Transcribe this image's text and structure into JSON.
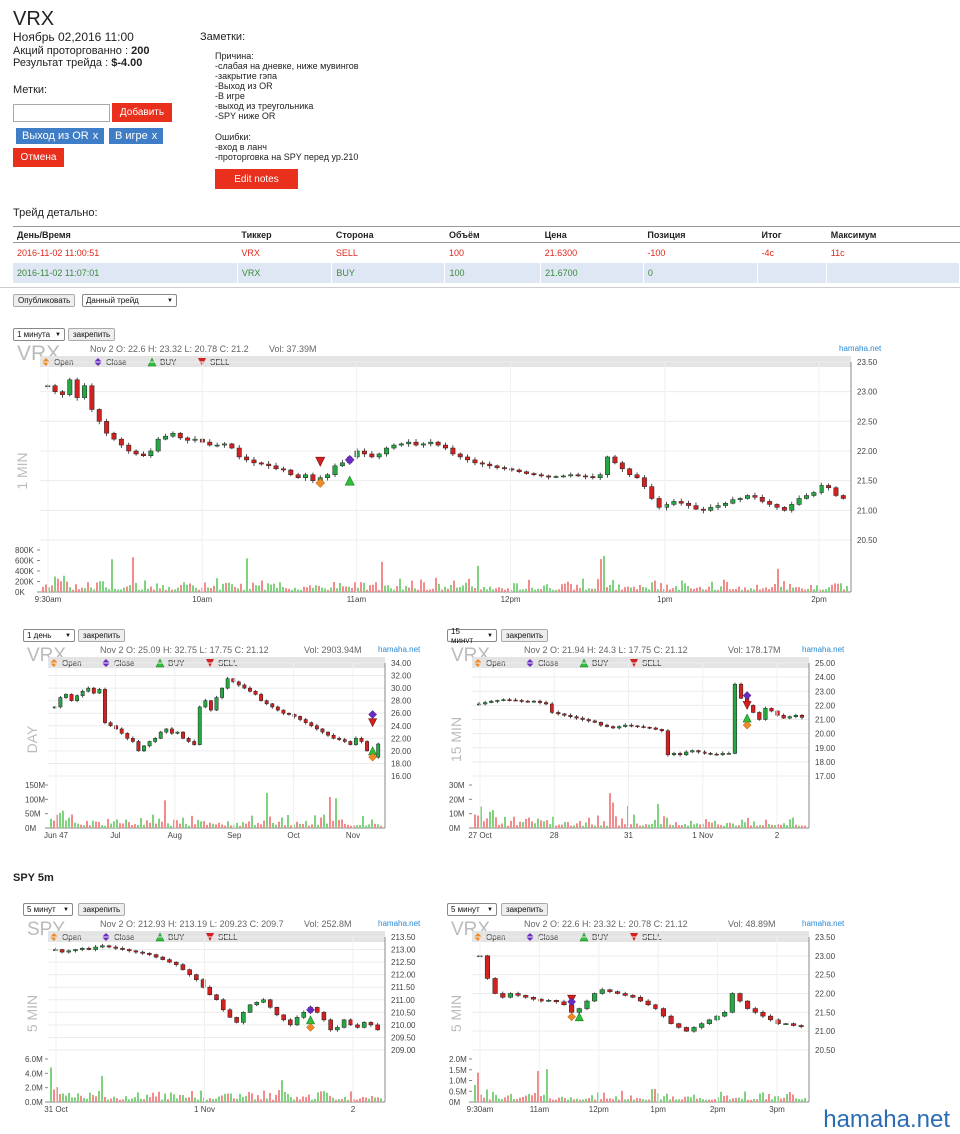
{
  "header": {
    "ticker": "VRX",
    "date": "Ноябрь 02,2016 11:00",
    "shares_label": "Акций проторгованно :",
    "shares_value": "200",
    "result_label": "Результат трейда :",
    "result_value": "$-4.00"
  },
  "tags": {
    "label": "Метки:",
    "input_value": "",
    "add_button": "Добавить",
    "chips": [
      "Выход из OR",
      "В игре"
    ],
    "chip_remove": "x",
    "cancel_button": "Отмена"
  },
  "notes": {
    "label": "Заметки:",
    "reasons_title": "Причина:",
    "reasons": [
      "-слабая на дневке, ниже мувингов",
      "-закрытие гэпа",
      "-Выход из OR",
      "-В игре",
      "-выход из треугольника",
      "-SPY ниже OR"
    ],
    "errors_title": "Ошибки:",
    "errors": [
      "-вход в ланч",
      "-проторговка на SPY перед ур.210"
    ],
    "edit_button": "Edit notes"
  },
  "trade_detail": {
    "label": "Трейд детально:",
    "columns": [
      "День/Время",
      "Тиккер",
      "Сторона",
      "Объём",
      "Цена",
      "Позиция",
      "Итог",
      "Максимум"
    ],
    "rows": [
      [
        "2016-11-02 11:00:51",
        "VRX",
        "SELL",
        "100",
        "21.6300",
        "-100",
        "-4c",
        "11c"
      ],
      [
        "2016-11-02 11:07:01",
        "VRX",
        "BUY",
        "100",
        "21.6700",
        "0",
        "",
        ""
      ]
    ]
  },
  "actions": {
    "publish_button": "Опубликовать",
    "scope_select": "Данный трейд"
  },
  "spy_label": "SPY 5m",
  "watermark": "hamaha.net",
  "colors": {
    "up": "#27a744",
    "down": "#d32020",
    "vol_up": "#7fd37f",
    "vol_down": "#f28b8b",
    "accent_red": "#e8301d",
    "chip_blue": "#3f7ec6",
    "link_blue": "#2a8ad4"
  },
  "charts": [
    {
      "id": "c1",
      "interval_select": "1 минута",
      "pin_button": "закрепить",
      "symbol": "VRX",
      "tf_label": "1 MIN",
      "info": "Nov 2 O: 22.6 H: 23.32 L: 20.78 C: 21.2",
      "vol": "Vol: 37.39M",
      "brand": "hamaha.net",
      "legend": [
        "Open",
        "Close",
        "BUY",
        "SELL"
      ],
      "y_ticks": [
        "23.50",
        "23.00",
        "22.50",
        "22.00",
        "21.50",
        "21.00",
        "20.50"
      ],
      "vol_ticks": [
        "800K",
        "600K",
        "400K",
        "200K",
        "0K"
      ],
      "x_ticks": [
        "9:30am",
        "10am",
        "11am",
        "12pm",
        "1pm",
        "2pm"
      ],
      "ylim": [
        20.5,
        23.5
      ],
      "volmax": 800000,
      "points": [
        23.1,
        23.0,
        22.95,
        23.2,
        22.9,
        23.1,
        22.7,
        22.5,
        22.3,
        22.2,
        22.1,
        22.0,
        21.95,
        21.92,
        22.0,
        22.2,
        22.25,
        22.3,
        22.22,
        22.18,
        22.2,
        22.15,
        22.1,
        22.1,
        22.12,
        22.05,
        21.9,
        21.85,
        21.8,
        21.78,
        21.75,
        21.7,
        21.68,
        21.6,
        21.55,
        21.6,
        21.5,
        21.55,
        21.6,
        21.75,
        21.8,
        21.9,
        22.0,
        21.95,
        21.9,
        21.95,
        22.05,
        22.1,
        22.12,
        22.15,
        22.1,
        22.12,
        22.15,
        22.1,
        22.05,
        21.95,
        21.9,
        21.85,
        21.8,
        21.78,
        21.75,
        21.72,
        21.7,
        21.68,
        21.65,
        21.62,
        21.6,
        21.58,
        21.56,
        21.57,
        21.58,
        21.6,
        21.58,
        21.57,
        21.55,
        21.6,
        21.9,
        21.8,
        21.7,
        21.6,
        21.55,
        21.4,
        21.2,
        21.05,
        21.1,
        21.15,
        21.12,
        21.08,
        21.02,
        21.0,
        21.05,
        21.08,
        21.12,
        21.18,
        21.2,
        21.25,
        21.22,
        21.15,
        21.1,
        21.05,
        21.0,
        21.1,
        21.2,
        21.25,
        21.3,
        21.42,
        21.38,
        21.25,
        21.2
      ],
      "markers": [
        {
          "type": "sell",
          "i": 37,
          "v": 21.82
        },
        {
          "type": "close",
          "i": 41,
          "v": 21.85
        },
        {
          "type": "open",
          "i": 37,
          "v": 21.46
        },
        {
          "type": "buy",
          "i": 41,
          "v": 21.5
        }
      ]
    },
    {
      "id": "c2",
      "interval_select": "1 день",
      "pin_button": "закрепить",
      "symbol": "VRX",
      "tf_label": "DAY",
      "info": "Nov 2 O: 25.09 H: 32.75 L: 17.75 C: 21.12",
      "vol": "Vol: 2903.94M",
      "brand": "hamaha.net",
      "legend": [
        "Open",
        "Close",
        "BUY",
        "SELL"
      ],
      "y_ticks": [
        "34.00",
        "32.00",
        "30.00",
        "28.00",
        "26.00",
        "24.00",
        "22.00",
        "20.00",
        "18.00",
        "16.00"
      ],
      "vol_ticks": [
        "150M",
        "100M",
        "50M",
        "0M"
      ],
      "x_ticks": [
        "Jun 47",
        "Jul",
        "Aug",
        "Sep",
        "Oct",
        "Nov"
      ],
      "ylim": [
        16,
        34
      ],
      "volmax": 150000000,
      "points": [
        27.0,
        28.5,
        29.0,
        28.0,
        28.8,
        29.5,
        30.0,
        29.2,
        29.8,
        24.5,
        24.0,
        23.5,
        22.8,
        22.0,
        21.5,
        20.0,
        20.8,
        21.5,
        22.0,
        23.0,
        23.5,
        22.8,
        23.0,
        22.0,
        21.5,
        21.0,
        27.0,
        28.0,
        26.5,
        28.5,
        30.0,
        31.5,
        31.0,
        30.5,
        30.0,
        29.5,
        29.0,
        28.0,
        27.5,
        27.0,
        26.5,
        26.0,
        25.8,
        25.5,
        25.0,
        24.5,
        24.0,
        23.5,
        23.0,
        22.5,
        22.0,
        21.8,
        21.5,
        21.0,
        22.0,
        21.5,
        20.0,
        19.0,
        21.1
      ],
      "markers": [
        {
          "type": "close",
          "i": 57,
          "v": 25.8
        },
        {
          "type": "sell",
          "i": 57,
          "v": 24.5
        },
        {
          "type": "buy",
          "i": 57,
          "v": 20.0
        },
        {
          "type": "open",
          "i": 57,
          "v": 19.0
        }
      ]
    },
    {
      "id": "c3",
      "interval_select": "15 минут",
      "pin_button": "закрепить",
      "symbol": "VRX",
      "tf_label": "15 MIN",
      "info": "Nov 2 O: 21.94 H: 24.3 L: 17.75 C: 21.12",
      "vol": "Vol: 178.17M",
      "brand": "hamaha.net",
      "legend": [
        "Open",
        "Close",
        "BUY",
        "SELL"
      ],
      "y_ticks": [
        "25.00",
        "24.00",
        "23.00",
        "22.00",
        "21.00",
        "20.00",
        "19.00",
        "18.00",
        "17.00"
      ],
      "vol_ticks": [
        "30M",
        "20M",
        "10M",
        "0M"
      ],
      "x_ticks": [
        "27 Oct",
        "28",
        "31",
        "1 Nov",
        "2"
      ],
      "ylim": [
        17,
        25
      ],
      "volmax": 30000000,
      "points": [
        22.1,
        22.2,
        22.3,
        22.35,
        22.4,
        22.38,
        22.35,
        22.3,
        22.25,
        22.3,
        22.2,
        22.1,
        21.5,
        21.4,
        21.3,
        21.2,
        21.1,
        21.0,
        20.9,
        20.8,
        20.6,
        20.5,
        20.4,
        20.5,
        20.6,
        20.55,
        20.5,
        20.45,
        20.4,
        20.3,
        20.2,
        18.5,
        18.6,
        18.5,
        18.7,
        18.8,
        18.7,
        18.6,
        18.55,
        18.5,
        18.6,
        18.6,
        23.5,
        22.5,
        22.0,
        21.5,
        21.0,
        21.8,
        21.6,
        21.3,
        21.1,
        21.2,
        21.3,
        21.15
      ],
      "markers": [
        {
          "type": "close",
          "i": 44,
          "v": 22.7
        },
        {
          "type": "sell",
          "i": 44,
          "v": 22.0
        },
        {
          "type": "buy",
          "i": 44,
          "v": 21.1
        },
        {
          "type": "open",
          "i": 44,
          "v": 20.6
        }
      ]
    },
    {
      "id": "c4",
      "interval_select": "5 минут",
      "pin_button": "закрепить",
      "symbol": "SPY",
      "tf_label": "5 MIN",
      "info": "Nov 2 O: 212.93 H: 213.19 L: 209.23 C: 209.7",
      "vol": "Vol: 252.8M",
      "brand": "hamaha.net",
      "legend": [
        "Open",
        "Close",
        "BUY",
        "SELL"
      ],
      "y_ticks": [
        "213.50",
        "213.00",
        "212.50",
        "212.00",
        "211.50",
        "211.00",
        "210.50",
        "210.00",
        "209.50",
        "209.00"
      ],
      "vol_ticks": [
        "6.0M",
        "4.0M",
        "2.0M",
        "0.0M"
      ],
      "x_ticks": [
        "31 Oct",
        "1 Nov",
        "2"
      ],
      "ylim": [
        209,
        213.5
      ],
      "volmax": 6000000,
      "points": [
        213.0,
        212.9,
        212.95,
        213.0,
        213.05,
        213.0,
        213.1,
        213.15,
        213.1,
        213.05,
        213.0,
        212.95,
        212.9,
        212.85,
        212.8,
        212.7,
        212.6,
        212.5,
        212.4,
        212.2,
        212.0,
        211.8,
        211.5,
        211.2,
        211.0,
        210.6,
        210.3,
        210.1,
        210.5,
        210.8,
        210.9,
        211.0,
        210.7,
        210.4,
        210.2,
        210.0,
        210.3,
        210.5,
        210.7,
        210.5,
        210.2,
        209.8,
        209.9,
        210.2,
        210.0,
        209.9,
        210.1,
        210.0,
        209.8
      ],
      "markers": [
        {
          "type": "close",
          "i": 38,
          "v": 210.6
        },
        {
          "type": "buy",
          "i": 38,
          "v": 210.2
        },
        {
          "type": "open",
          "i": 38,
          "v": 209.9
        }
      ]
    },
    {
      "id": "c5",
      "interval_select": "5 минут",
      "pin_button": "закрепить",
      "symbol": "VRX",
      "tf_label": "5 MIN",
      "info": "Nov 2 O: 22.6 H: 23.32 L: 20.78 C: 21.12",
      "vol": "Vol: 48.89M",
      "brand": "hamaha.net",
      "legend": [
        "Open",
        "Close",
        "BUY",
        "SELL"
      ],
      "y_ticks": [
        "23.50",
        "23.00",
        "22.50",
        "22.00",
        "21.50",
        "21.00",
        "20.50"
      ],
      "vol_ticks": [
        "2.0M",
        "1.5M",
        "1.0M",
        "0.5M",
        "0M"
      ],
      "x_ticks": [
        "9:30am",
        "11am",
        "12pm",
        "1pm",
        "2pm",
        "3pm"
      ],
      "ylim": [
        20.5,
        23.5
      ],
      "volmax": 2000000,
      "points": [
        23.0,
        22.4,
        22.0,
        21.9,
        22.0,
        21.95,
        21.9,
        21.85,
        21.8,
        21.82,
        21.78,
        21.7,
        21.5,
        21.6,
        21.8,
        22.0,
        22.1,
        22.05,
        22.0,
        21.95,
        21.9,
        21.8,
        21.7,
        21.6,
        21.4,
        21.2,
        21.1,
        21.0,
        21.1,
        21.2,
        21.3,
        21.4,
        21.5,
        22.0,
        21.8,
        21.6,
        21.5,
        21.4,
        21.3,
        21.2,
        21.2,
        21.15,
        21.12
      ],
      "markers": [
        {
          "type": "sell",
          "i": 12,
          "v": 21.85
        },
        {
          "type": "close",
          "i": 12,
          "v": 21.78
        },
        {
          "type": "open",
          "i": 12,
          "v": 21.38
        },
        {
          "type": "buy",
          "i": 13,
          "v": 21.38
        }
      ]
    }
  ]
}
